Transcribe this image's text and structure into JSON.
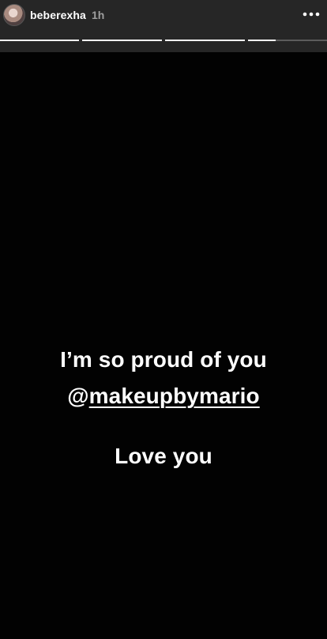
{
  "story": {
    "username": "beberexha",
    "time": "1h",
    "more_icon": "more-horizontal-icon",
    "progress": [
      1,
      1,
      1,
      0.35
    ],
    "text": {
      "line1": "I’m so proud of you",
      "line2_prefix": "@",
      "mention": "makeupbymario",
      "line3": "Love you"
    }
  },
  "colors": {
    "header_background": "#262626",
    "content_background": "#020202",
    "text": "#ffffff",
    "timestamp": "#9e9e9e"
  }
}
